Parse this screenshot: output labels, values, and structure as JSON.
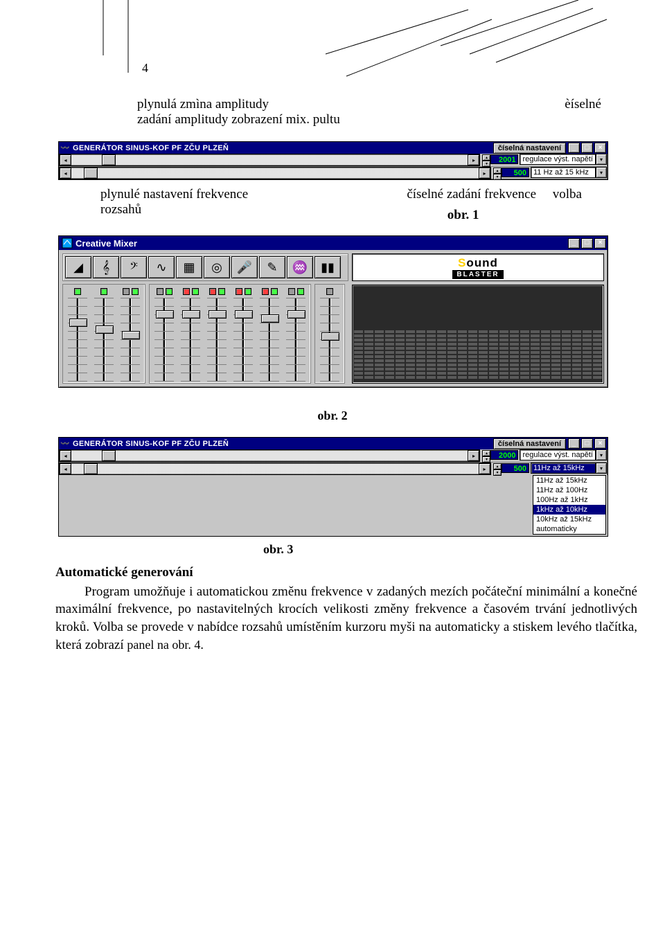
{
  "page_number": "4",
  "intro": {
    "line1_left": "plynulá zmìna amplitudy",
    "line1_right": "èíselné",
    "line2": "zadání amplitudy   zobrazení mix. pultu"
  },
  "gen1": {
    "title": "GENERÁTOR SINUS-KOF PF ZČU PLZEŇ",
    "settings_label": "číselná nastavení",
    "row1_value": "2001",
    "row1_right": "regulace výst. napětí",
    "row2_value": "500",
    "row2_combo": "11 Hz až 15 kHz"
  },
  "mid": {
    "left_l1": "plynulé nastavení frekvence",
    "left_l2": "rozsahů",
    "right_a": "číselné zadání frekvence",
    "right_b": "volba",
    "fig1": "obr. 1"
  },
  "mixer": {
    "title": "Creative Mixer",
    "icons": [
      "volume-icon",
      "treble-icon",
      "bass-icon",
      "wave-icon",
      "midi-icon",
      "cd-icon",
      "mic-icon",
      "mic2-icon",
      "lfe-icon",
      "bars-icon"
    ],
    "logo_top": "Sound",
    "logo_bottom": "BLASTER",
    "leds": [
      [
        "g"
      ],
      [
        "g"
      ],
      [
        "",
        "g"
      ],
      [
        "",
        "g"
      ],
      [
        "r",
        "g"
      ],
      [
        "r",
        "g"
      ],
      [
        "r",
        "g"
      ],
      [
        "r",
        "g"
      ],
      [
        "",
        "g"
      ],
      [
        ""
      ]
    ],
    "knob_pos": [
      30,
      40,
      48,
      18,
      18,
      18,
      18,
      24,
      18,
      50
    ],
    "fig2": "obr. 2"
  },
  "gen3": {
    "title": "GENERÁTOR SINUS-KOF PF ZČU PLZEŇ",
    "settings_label": "číselná nastavení",
    "row1_value": "2000",
    "row1_right": "regulace výst. napětí",
    "row2_value": "500",
    "row2_combo": "11Hz až 15kHz",
    "dropdown": [
      "11Hz až 15kHz",
      "11Hz až 100Hz",
      "100Hz až 1kHz",
      "1kHz až 10kHz",
      "10kHz až 15kHz",
      "automaticky"
    ],
    "dropdown_sel": 3,
    "fig3": "obr. 3"
  },
  "para": {
    "heading": "Automatické generování",
    "body_1": "Program umožňuje i automatickou změnu frekvence v zadaných mezích počáteční minimální a konečné maximální  frekvence, po nastavitelných krocích velikosti  změny frekvence a časovém trvání jednotlivých kroků. Volba  se  provede  v nabídce  rozsahů  umístěním  kurzoru  myši  na  automaticky a stiskem levého tlačítka, která zobrazí ",
    "body_2": "panel na obr. 4."
  },
  "win_btn": {
    "min": "_",
    "max": "□",
    "close": "×"
  }
}
